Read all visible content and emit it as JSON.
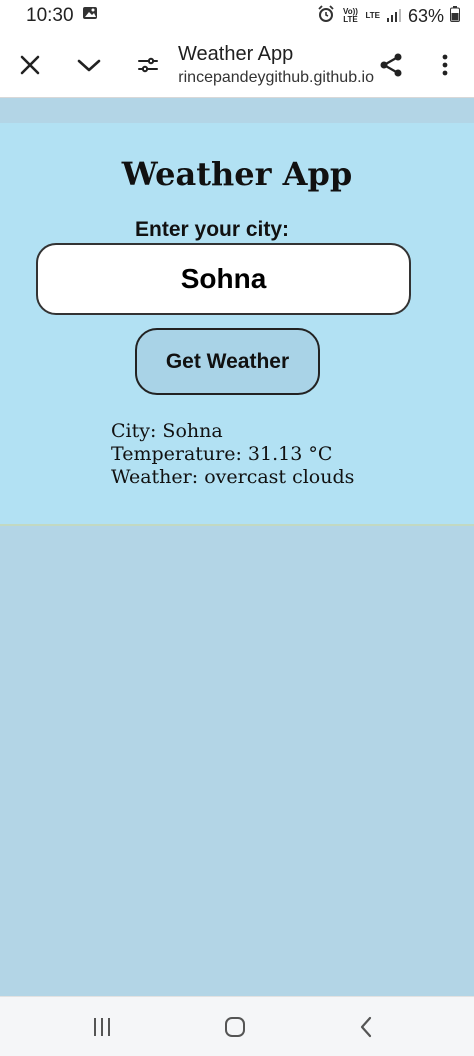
{
  "status_bar": {
    "time": "10:30",
    "volte_label": "Vo)) LTE",
    "lte_label": "LTE",
    "battery": "63%"
  },
  "toolbar": {
    "title": "Weather App",
    "url": "princepandeygithub.github.io"
  },
  "app": {
    "title": "Weather App",
    "city_label": "Enter your city:",
    "city_value": "Sohna",
    "button_label": "Get Weather",
    "result": {
      "city": "City: Sohna",
      "temperature": "Temperature: 31.13 °C",
      "weather": "Weather: overcast clouds"
    }
  },
  "colors": {
    "page_bg": "#b3d5e6",
    "card_bg": "#b2e1f3",
    "button_bg": "#a9d3e7"
  },
  "icons": {
    "close": "close-icon",
    "chevron": "chevron-down-icon",
    "tune": "tune-icon",
    "share": "share-icon",
    "more": "more-vert-icon",
    "recents": "recents-icon",
    "home": "home-icon",
    "back": "back-icon"
  }
}
